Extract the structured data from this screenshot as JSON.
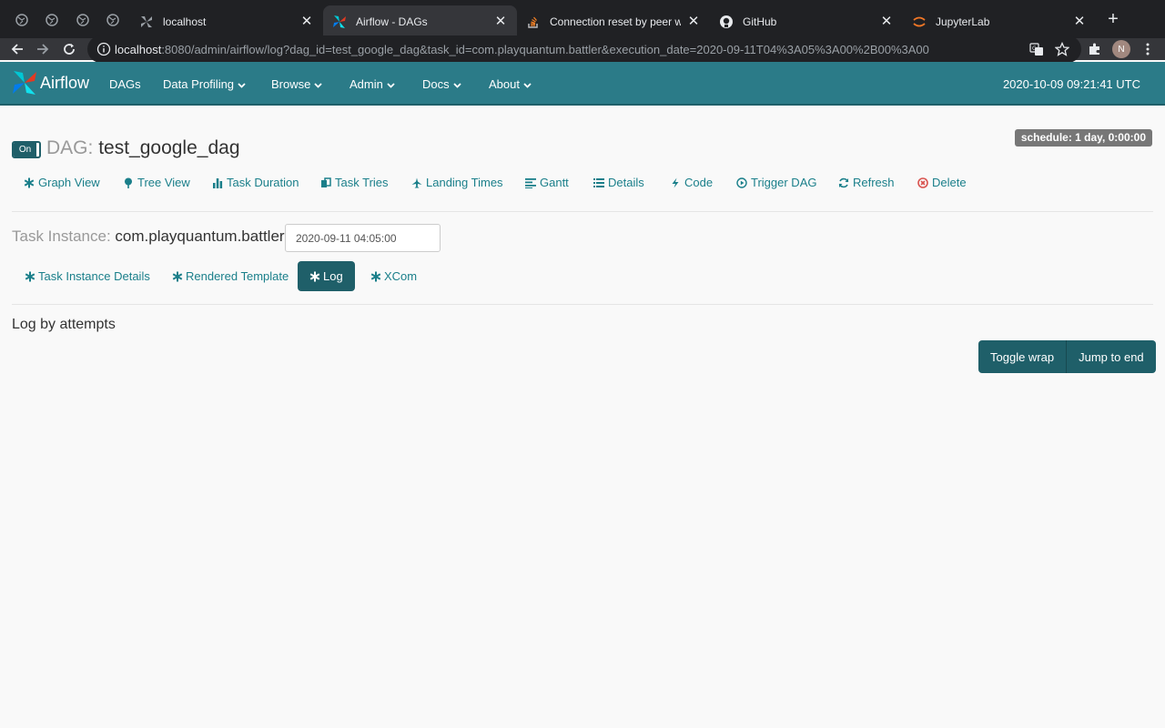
{
  "browser": {
    "tabs": [
      {
        "title": "localhost",
        "active": false
      },
      {
        "title": "Airflow - DAGs",
        "active": true
      },
      {
        "title": "Connection reset by peer wher",
        "active": false
      },
      {
        "title": "GitHub",
        "active": false
      },
      {
        "title": "JupyterLab",
        "active": false
      }
    ],
    "url_host": "localhost",
    "url_rest": ":8080/admin/airflow/log?dag_id=test_google_dag&task_id=com.playquantum.battler&execution_date=2020-09-11T04%3A05%3A00%2B00%3A00",
    "avatar_initial": "N"
  },
  "navbar": {
    "brand": "Airflow",
    "items": [
      "DAGs",
      "Data Profiling",
      "Browse",
      "Admin",
      "Docs",
      "About"
    ],
    "clock": "2020-10-09 09:21:41 UTC"
  },
  "dag": {
    "toggle": "On",
    "label": "DAG:",
    "name": "test_google_dag",
    "schedule": "schedule: 1 day, 0:00:00"
  },
  "dag_nav": [
    "Graph View",
    "Tree View",
    "Task Duration",
    "Task Tries",
    "Landing Times",
    "Gantt",
    "Details",
    "Code",
    "Trigger DAG",
    "Refresh",
    "Delete"
  ],
  "task_instance": {
    "label": "Task Instance:",
    "name": "com.playquantum.battler",
    "execution_date": "2020-09-11 04:05:00"
  },
  "ti_nav": [
    "Task Instance Details",
    "Rendered Template",
    "Log",
    "XCom"
  ],
  "log": {
    "heading": "Log by attempts",
    "toggle_wrap": "Toggle wrap",
    "jump_to_end": "Jump to end"
  },
  "colors": {
    "navbar": "#2b7b88",
    "accent": "#1f5f69",
    "link": "#1a7f8a",
    "delete": "#d9534f"
  }
}
